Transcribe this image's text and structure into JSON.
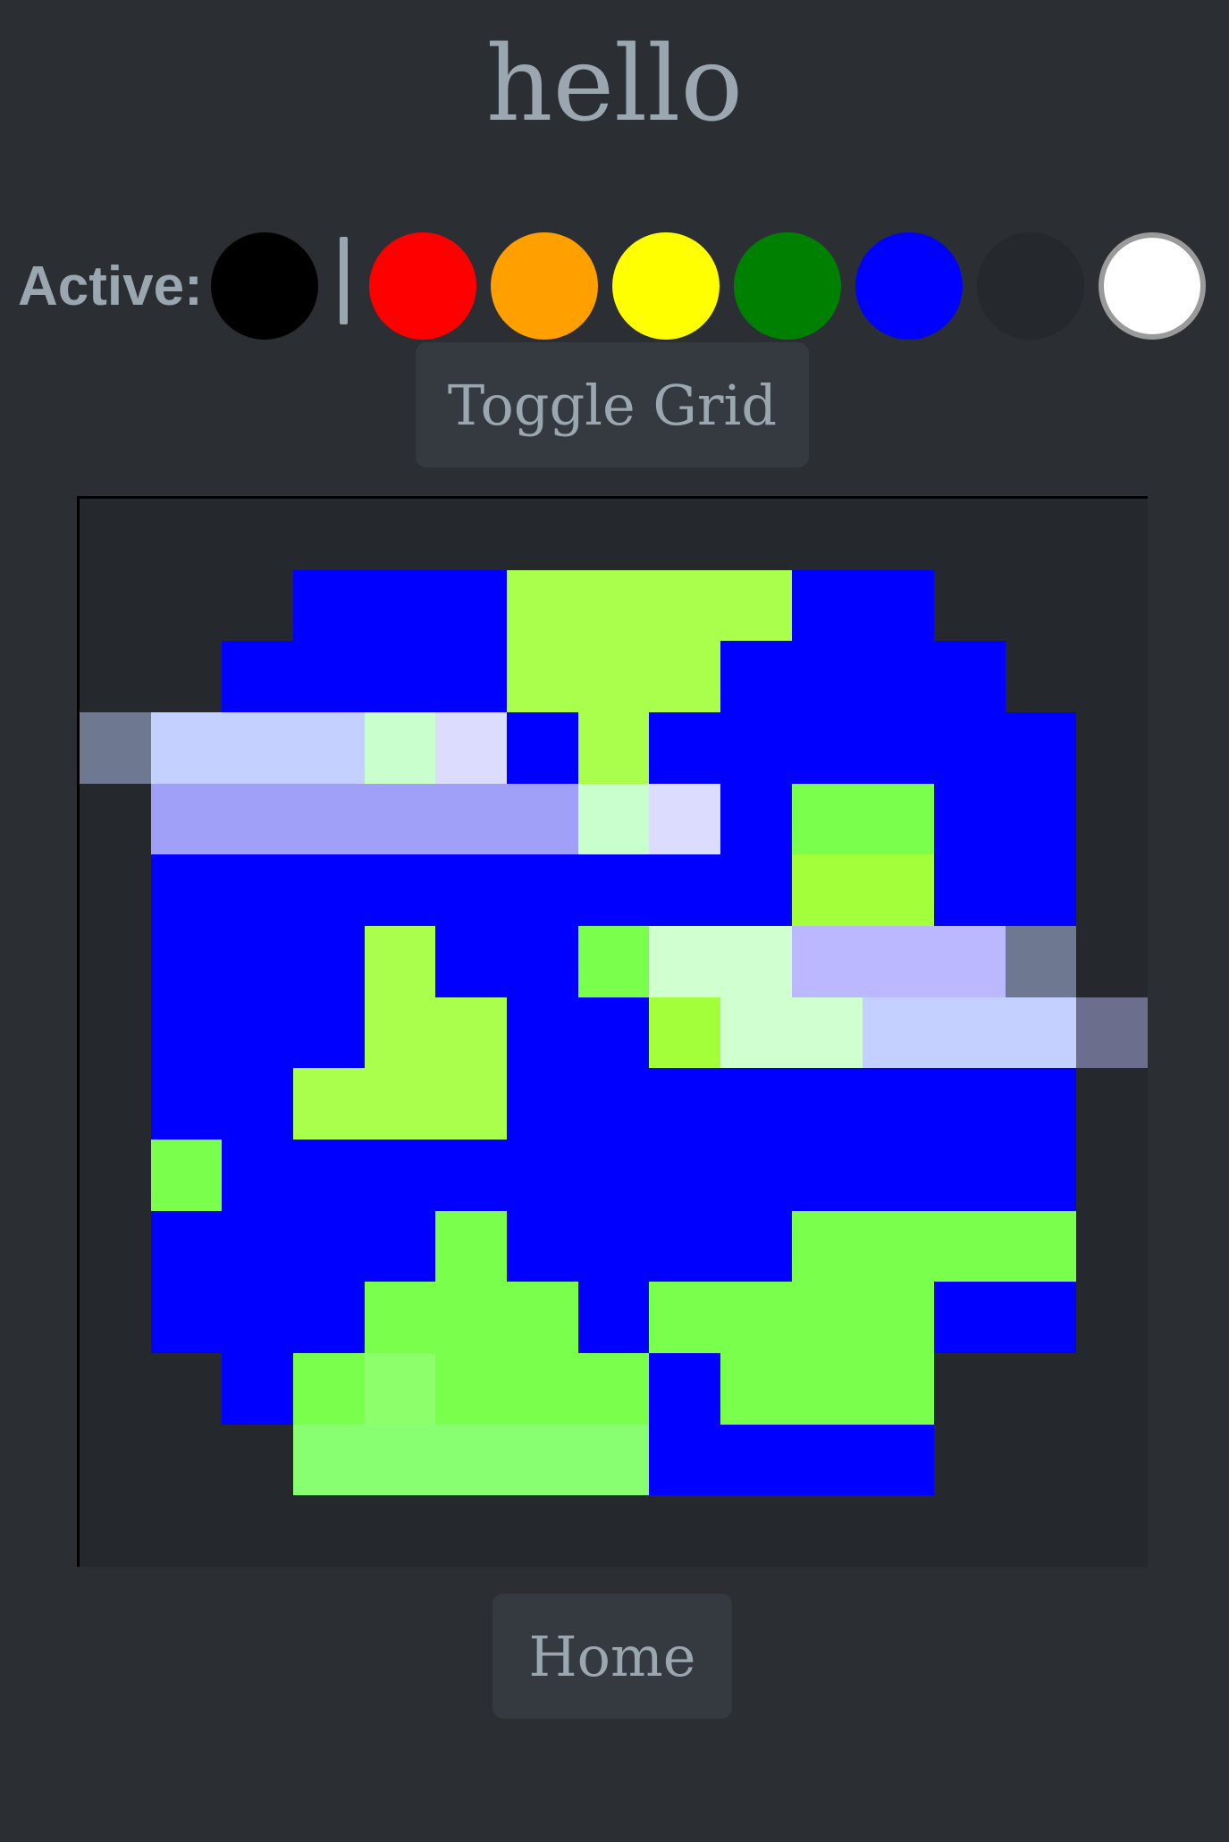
{
  "page": {
    "title": "hello"
  },
  "palette": {
    "active_label": "Active:",
    "active_color": "#000000",
    "colors": [
      {
        "name": "red",
        "hex": "#ff0000"
      },
      {
        "name": "orange",
        "hex": "#ffa000"
      },
      {
        "name": "yellow",
        "hex": "#ffff00"
      },
      {
        "name": "green",
        "hex": "#008000"
      },
      {
        "name": "blue",
        "hex": "#0000ff"
      },
      {
        "name": "dark",
        "hex": "#25282c"
      },
      {
        "name": "white",
        "hex": "#ffffff"
      }
    ]
  },
  "controls": {
    "toggle_grid_label": "Toggle Grid",
    "home_label": "Home"
  },
  "canvas": {
    "grid_size": 15,
    "legend": {
      ".": "#25282c",
      "B": "#0000ff",
      "L": "#aaff4c",
      "G": "#7aff4c",
      "M": "#8cff6a",
      "N": "#88ff70",
      "Y": "#a3ff3a",
      "C": "#c8ffcc",
      "c": "#d0ffd0",
      "W": "#dcdcff",
      "P": "#c4d0ff",
      "p": "#a0a0f8",
      "V": "#bcb8ff",
      "S": "#6e7890",
      "s": "#6c6e8e"
    },
    "rows": [
      "...............",
      "...BBBLLLLBB...",
      "..BBBBLLLBBBB..",
      "SPPPCWBLBBBBBB.",
      ".ppppppCWBGGBB.",
      ".BBBBBBBBBYYBB.",
      ".BBBLBBGccVVVS.",
      ".BBBLLBBYccPPPs",
      ".BBLLLBBBBBBBB.",
      ".GBBBBBBBBBBBB.",
      ".BBBBGBBBBGGGG.",
      ".BBBGGGBGGGGBB.",
      "..BGMGGGBGGG...",
      "...NNNNNBBBB...",
      "..............."
    ]
  }
}
